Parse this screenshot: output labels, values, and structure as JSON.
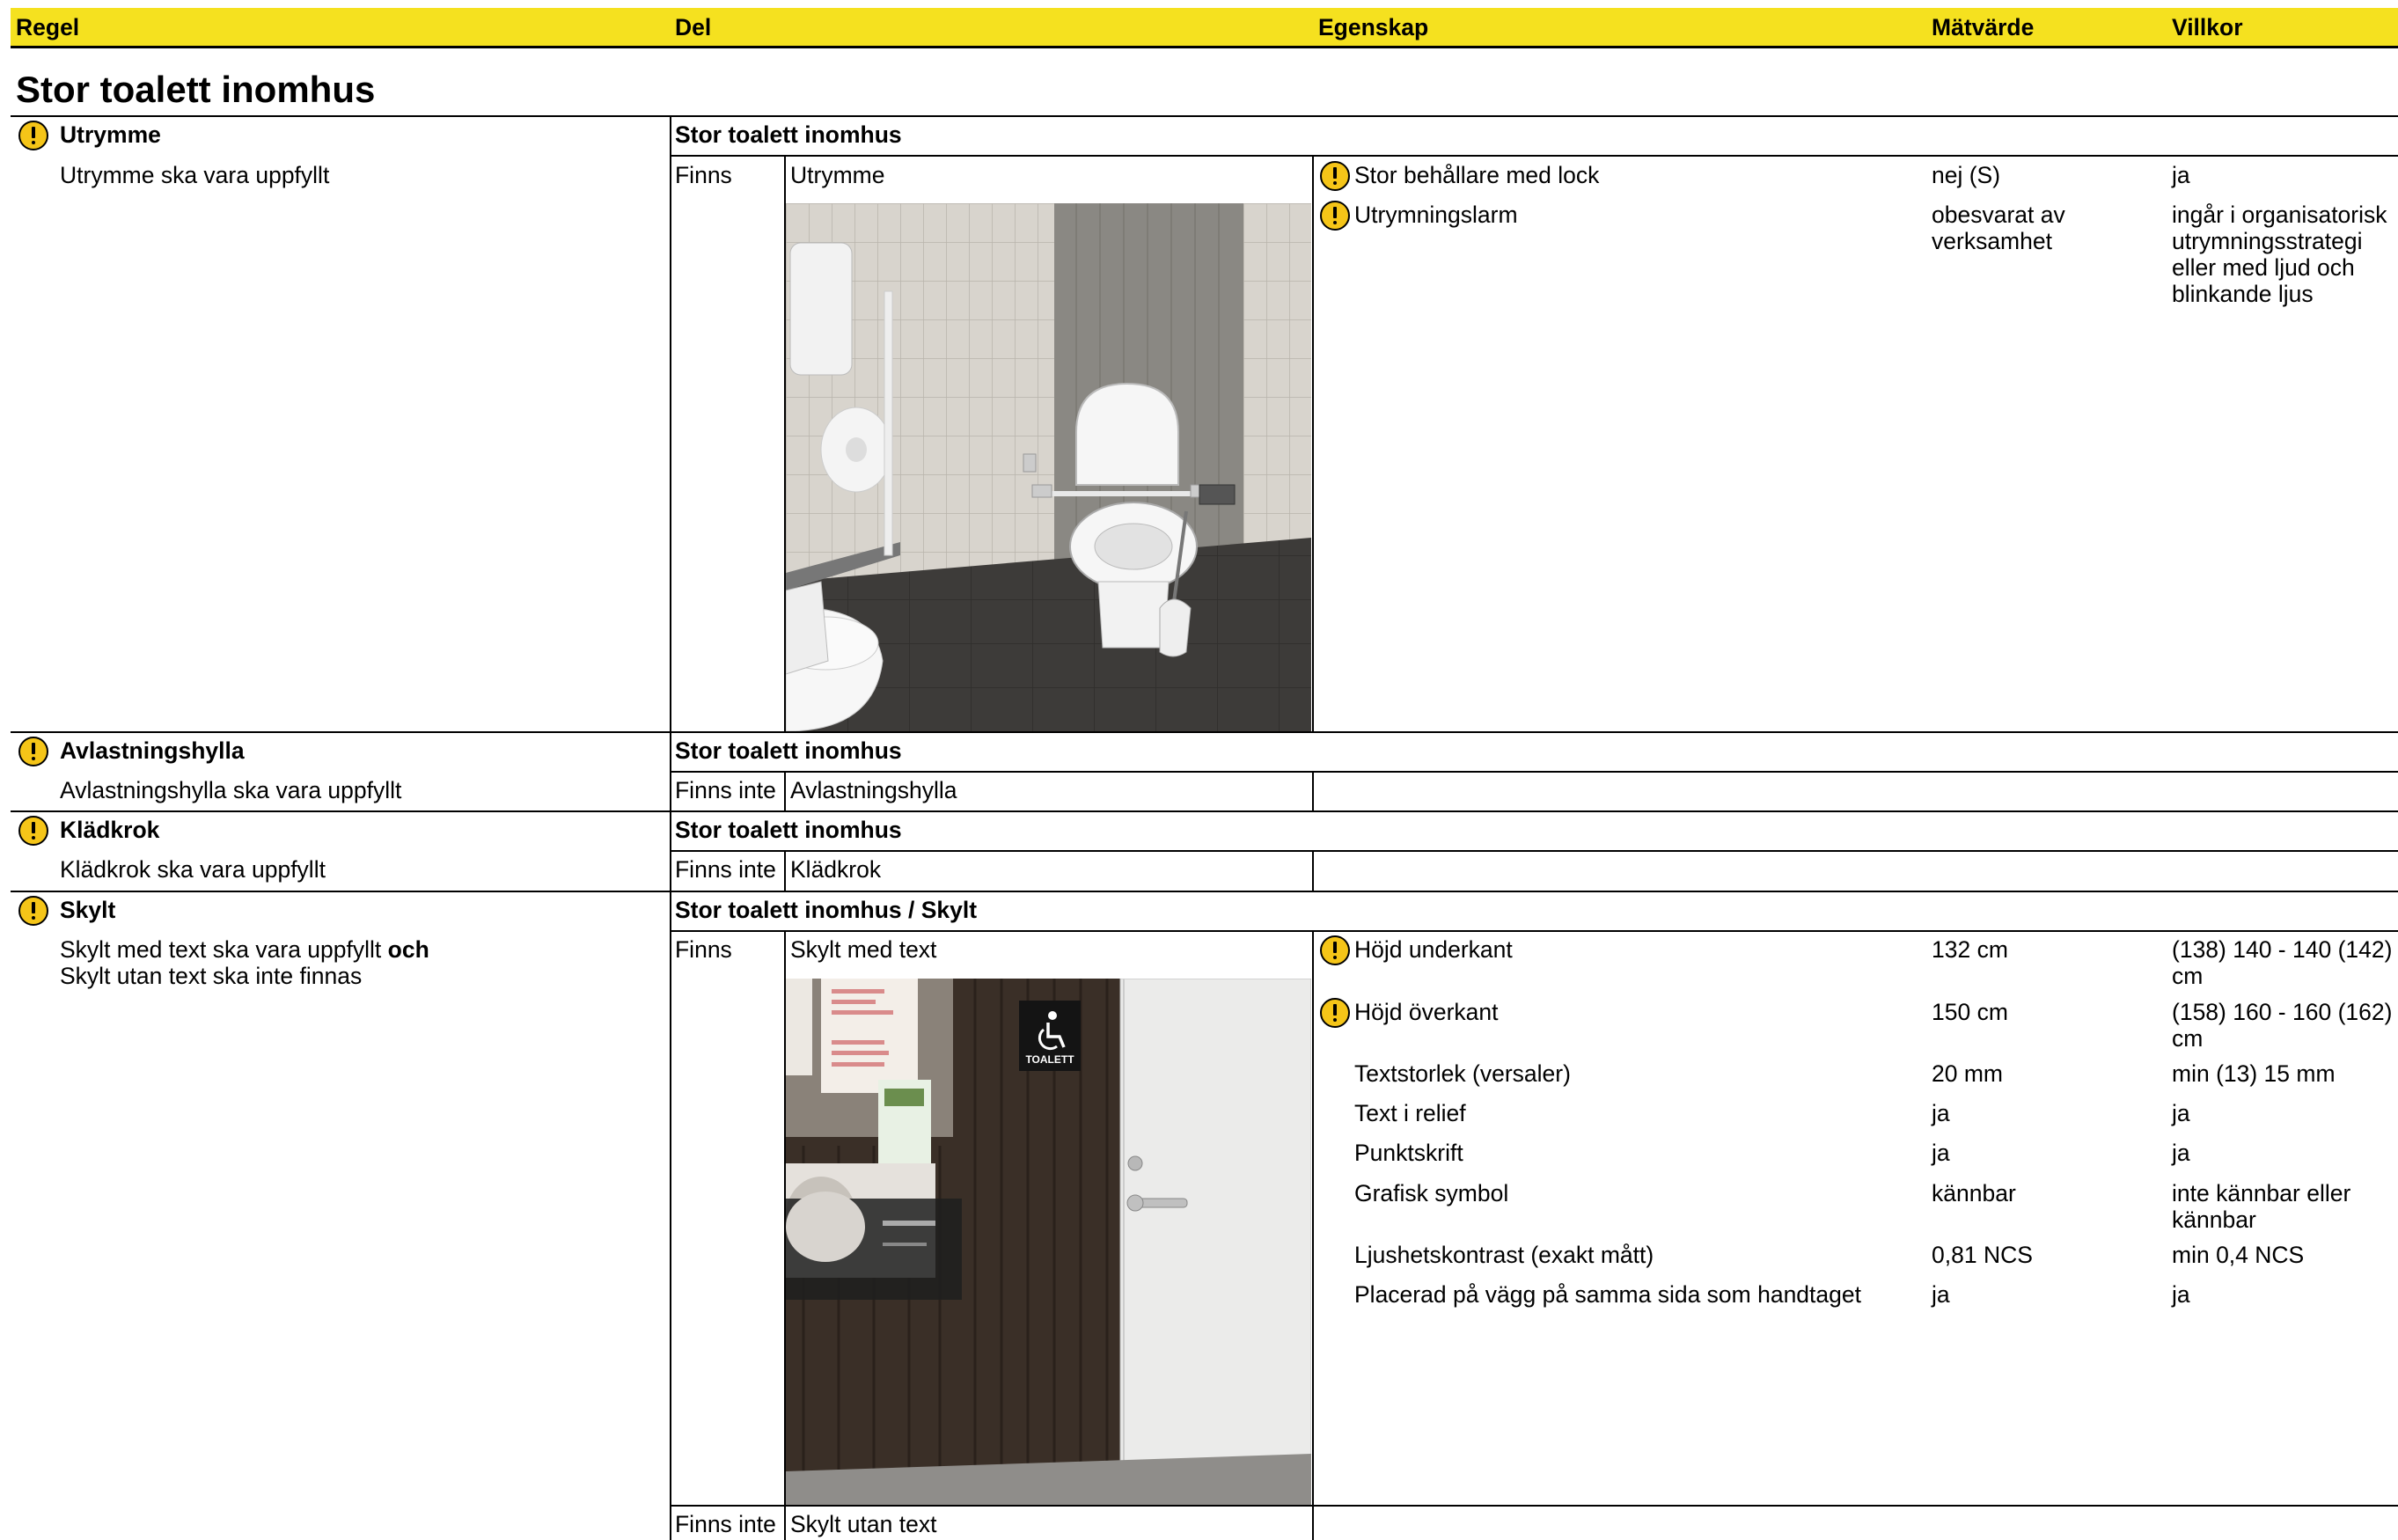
{
  "header": {
    "regel": "Regel",
    "del": "Del",
    "egenskap": "Egenskap",
    "matvarde": "Mätvärde",
    "villkor": "Villkor"
  },
  "page_title": "Stor toalett inomhus",
  "rules": {
    "utrymme": {
      "title": "Utrymme",
      "description": "Utrymme ska vara uppfyllt",
      "section": "Stor toalett inomhus",
      "status": "Finns",
      "part": "Utrymme",
      "properties": [
        {
          "name": "Stor behållare med lock",
          "value": "nej (S)",
          "condition": "ja"
        },
        {
          "name": "Utrymningslarm",
          "value": "obesvarat av verksamhet",
          "condition": "ingår i organisatorisk utrymningsstrategi eller med ljud och blinkande ljus"
        }
      ]
    },
    "avlastningshylla": {
      "title": "Avlastningshylla",
      "description": "Avlastningshylla ska vara uppfyllt",
      "section": "Stor toalett inomhus",
      "status": "Finns inte",
      "part": "Avlastningshylla"
    },
    "kladkrok": {
      "title": "Klädkrok",
      "description": "Klädkrok ska vara uppfyllt",
      "section": "Stor toalett inomhus",
      "status": "Finns inte",
      "part": "Klädkrok"
    },
    "skylt": {
      "title": "Skylt",
      "description_1": "Skylt med text ska vara uppfyllt",
      "description_och": "och",
      "description_2": "Skylt utan text ska inte finnas",
      "section": "Stor toalett inomhus / Skylt",
      "status": "Finns",
      "part": "Skylt med text",
      "status_2": "Finns inte",
      "part_2": "Skylt utan text",
      "properties": [
        {
          "name": "Höjd underkant",
          "value": "132 cm",
          "condition": "(138) 140 - 140 (142) cm"
        },
        {
          "name": "Höjd överkant",
          "value": "150 cm",
          "condition": "(158) 160 - 160 (162) cm"
        },
        {
          "name": "Textstorlek (versaler)",
          "value": "20 mm",
          "condition": "min (13) 15 mm"
        },
        {
          "name": "Text i relief",
          "value": "ja",
          "condition": "ja"
        },
        {
          "name": "Punktskrift",
          "value": "ja",
          "condition": "ja"
        },
        {
          "name": "Grafisk symbol",
          "value": "kännbar",
          "condition": "inte kännbar eller kännbar"
        },
        {
          "name": "Ljushetskontrast (exakt mått)",
          "value": "0,81 NCS",
          "condition": "min 0,4 NCS"
        },
        {
          "name": "Placerad på vägg på samma sida som handtaget",
          "value": "ja",
          "condition": "ja"
        }
      ]
    }
  },
  "sign_label": "TOALETT",
  "colors": {
    "header_bg": "#f5e11f",
    "warning": "#f5c518"
  }
}
